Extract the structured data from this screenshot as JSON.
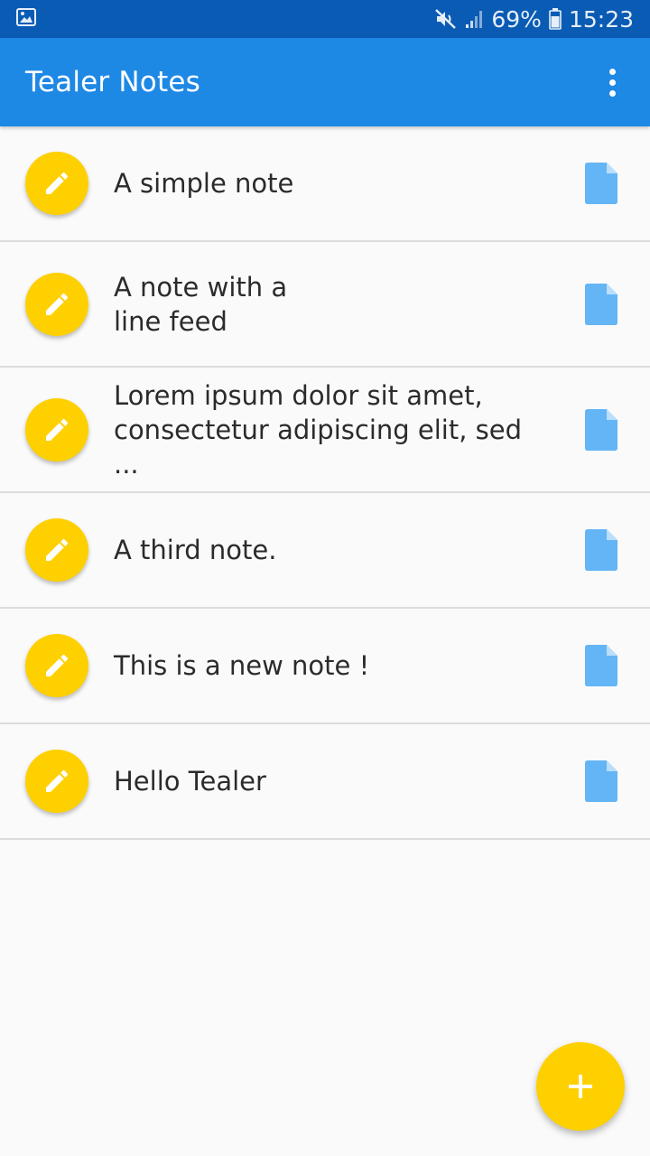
{
  "status_bar": {
    "battery": "69%",
    "time": "15:23",
    "icons": [
      "image-icon",
      "mute-icon",
      "signal-icon",
      "battery-icon"
    ]
  },
  "app_bar": {
    "title": "Tealer Notes",
    "menu_icon": "more-vert-icon",
    "color": "#1e88e5"
  },
  "notes": [
    {
      "text": "A simple note"
    },
    {
      "text": "A note with a\nline feed"
    },
    {
      "text": "Lorem ipsum dolor sit amet,\nconsectetur adipiscing elit, sed ..."
    },
    {
      "text": "A third note."
    },
    {
      "text": "This is a new note !"
    },
    {
      "text": "Hello Tealer"
    }
  ],
  "icons": {
    "note_leading": "pencil-icon",
    "note_trailing": "document-icon",
    "fab": "plus-icon"
  },
  "colors": {
    "accent": "#ffd000",
    "primary": "#1e88e5",
    "status_bar": "#0a5bb4",
    "document_icon": "#64b5f6"
  }
}
